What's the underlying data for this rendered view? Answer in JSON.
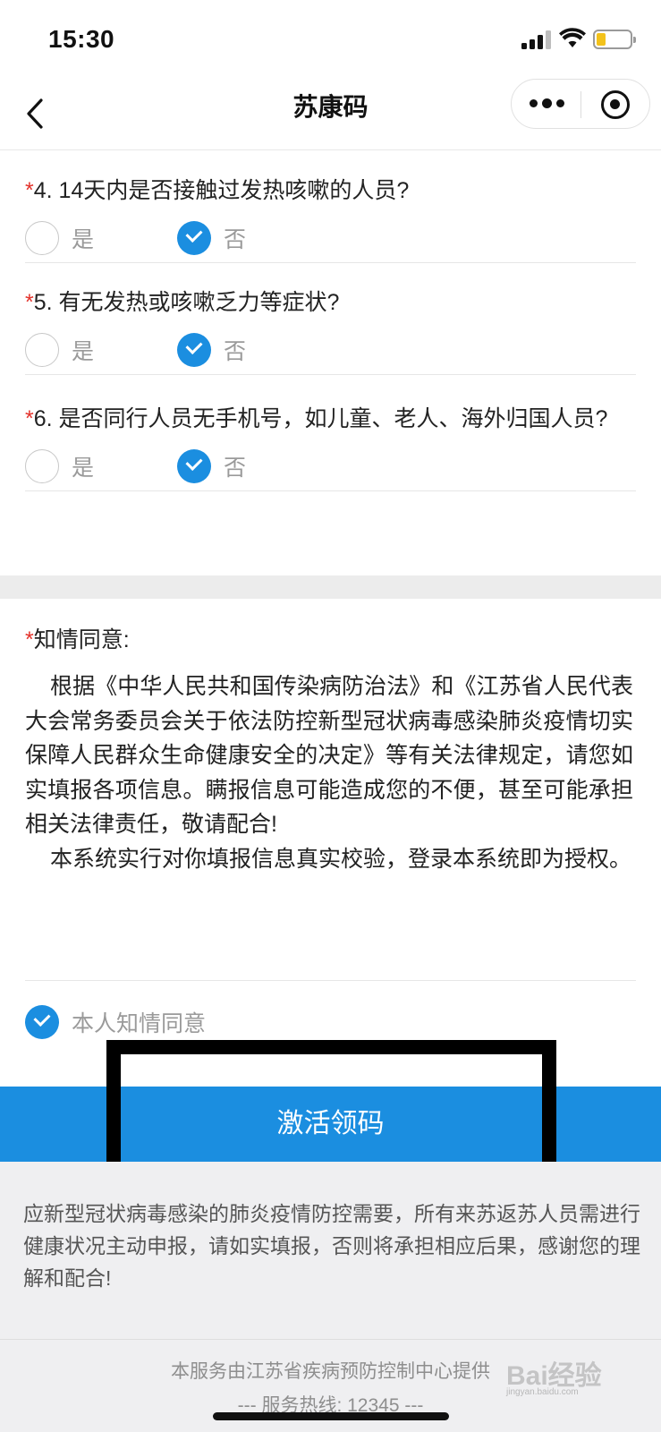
{
  "status_bar": {
    "time": "15:30"
  },
  "nav": {
    "title": "苏康码"
  },
  "questions": [
    {
      "number": "4.",
      "text": "14天内是否接触过发热咳嗽的人员?",
      "options": [
        "是",
        "否"
      ],
      "selected": "否"
    },
    {
      "number": "5.",
      "text": "有无发热或咳嗽乏力等症状?",
      "options": [
        "是",
        "否"
      ],
      "selected": "否"
    },
    {
      "number": "6.",
      "text": "是否同行人员无手机号，如儿童、老人、海外归国人员?",
      "options": [
        "是",
        "否"
      ],
      "selected": "否"
    }
  ],
  "required_mark": "*",
  "consent": {
    "title": "知情同意:",
    "paragraph1": "根据《中华人民共和国传染病防治法》和《江苏省人民代表大会常务委员会关于依法防控新型冠状病毒感染肺炎疫情切实保障人民群众生命健康安全的决定》等有关法律规定，请您如实填报各项信息。瞒报信息可能造成您的不便，甚至可能承担相关法律责任，敬请配合!",
    "paragraph2": "本系统实行对你填报信息真实校验，登录本系统即为授权。",
    "agree_label": "本人知情同意",
    "agreed": true
  },
  "activate_button": "激活领码",
  "notice": "应新型冠状病毒感染的肺炎疫情防控需要，所有来苏返苏人员需进行健康状况主动申报，请如实填报，否则将承担相应后果，感谢您的理解和配合!",
  "footer": {
    "provider": "本服务由江苏省疾病预防控制中心提供",
    "hotline": "--- 服务热线: 12345 ---"
  },
  "watermark": {
    "text": "Bai经验",
    "sub": "jingyan.baidu.com"
  },
  "colors": {
    "accent": "#1b8ee0",
    "required": "#e3322b"
  }
}
